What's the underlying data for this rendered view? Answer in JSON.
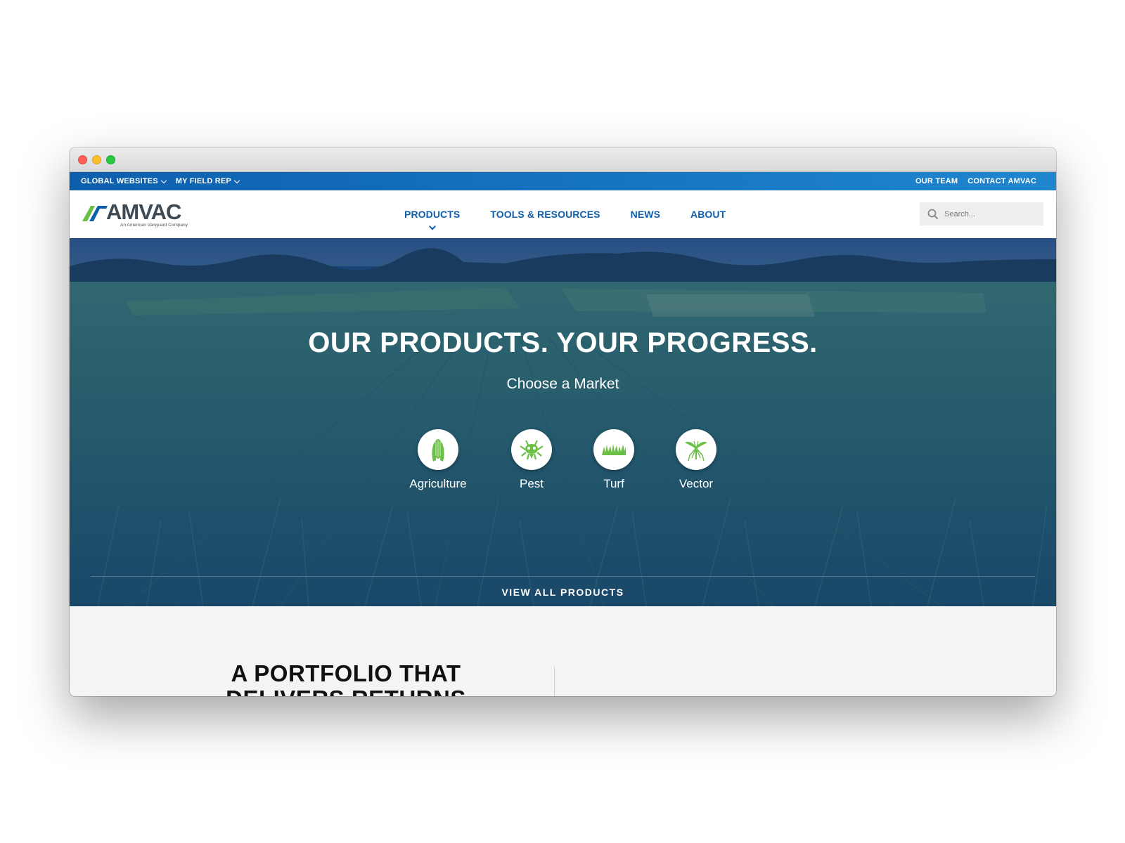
{
  "topbar": {
    "left_links": [
      "GLOBAL WEBSITES",
      "MY FIELD REP"
    ],
    "right_links": [
      "OUR TEAM",
      "CONTACT AMVAC"
    ]
  },
  "logo": {
    "name": "AMVAC",
    "tagline": "An American Vanguard Company"
  },
  "nav": {
    "items": [
      "PRODUCTS",
      "TOOLS & RESOURCES",
      "NEWS",
      "ABOUT"
    ],
    "active": "PRODUCTS"
  },
  "search": {
    "placeholder": "Search..."
  },
  "hero": {
    "title": "OUR PRODUCTS. YOUR PROGRESS.",
    "subtitle": "Choose a Market",
    "markets": [
      {
        "label": "Agriculture",
        "icon": "corn-icon"
      },
      {
        "label": "Pest",
        "icon": "ant-icon"
      },
      {
        "label": "Turf",
        "icon": "grass-icon"
      },
      {
        "label": "Vector",
        "icon": "mosquito-icon"
      }
    ],
    "cta": "VIEW ALL PRODUCTS"
  },
  "section": {
    "heading": "A PORTFOLIO THAT DELIVERS RETURNS"
  },
  "colors": {
    "brand_blue": "#0d5fae",
    "brand_green": "#6abf45",
    "hero_overlay": "#1b4f8f"
  }
}
